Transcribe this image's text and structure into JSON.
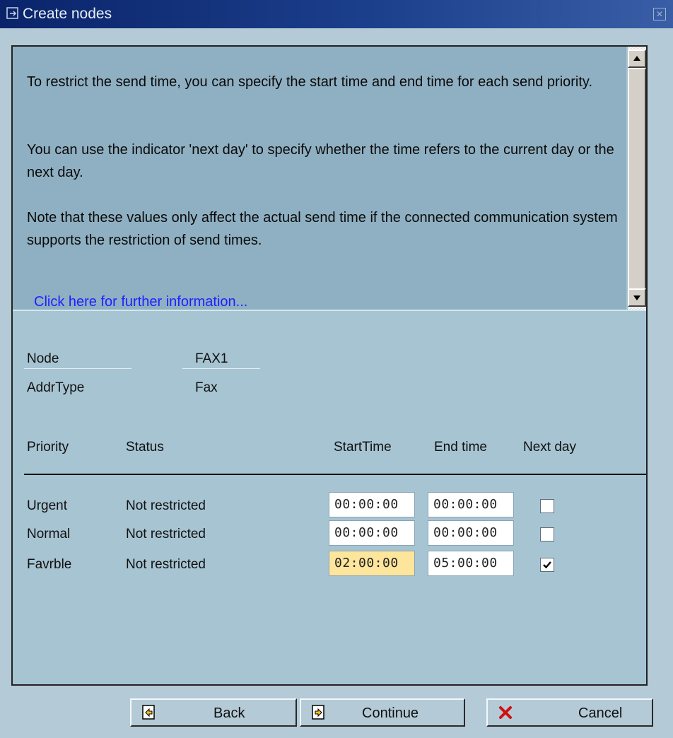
{
  "window": {
    "title": "Create nodes"
  },
  "info": {
    "paragraph1": "To restrict the send time, you can specify the start time and end time for each send priority.",
    "paragraph2": "You can use the indicator 'next day' to specify whether the time refers to the current day or the next day.",
    "paragraph3": "Note that these values only affect the actual send time if the connected communication system supports the restriction of send times.",
    "link": "Click here for further information..."
  },
  "fields": {
    "node_label": "Node",
    "node_value": "FAX1",
    "addrtype_label": "AddrType",
    "addrtype_value": "Fax"
  },
  "table": {
    "headers": {
      "priority": "Priority",
      "status": "Status",
      "start": "StartTime",
      "end": "End time",
      "next_day": "Next day"
    },
    "rows": [
      {
        "priority": "Urgent",
        "status": "Not restricted",
        "start": "00:00:00",
        "end": "00:00:00",
        "next_day": false
      },
      {
        "priority": "Normal",
        "status": "Not restricted",
        "start": "00:00:00",
        "end": "00:00:00",
        "next_day": false
      },
      {
        "priority": "Favrble",
        "status": "Not restricted",
        "start": "02:00:00",
        "end": "05:00:00",
        "next_day": true
      }
    ]
  },
  "buttons": {
    "back": "Back",
    "continue": "Continue",
    "cancel": "Cancel"
  },
  "colors": {
    "titlebar": "#0a246a",
    "background": "#b4cad6",
    "link": "#1f1fff",
    "active_field": "#fde59b",
    "cancel_icon": "#d01010"
  }
}
